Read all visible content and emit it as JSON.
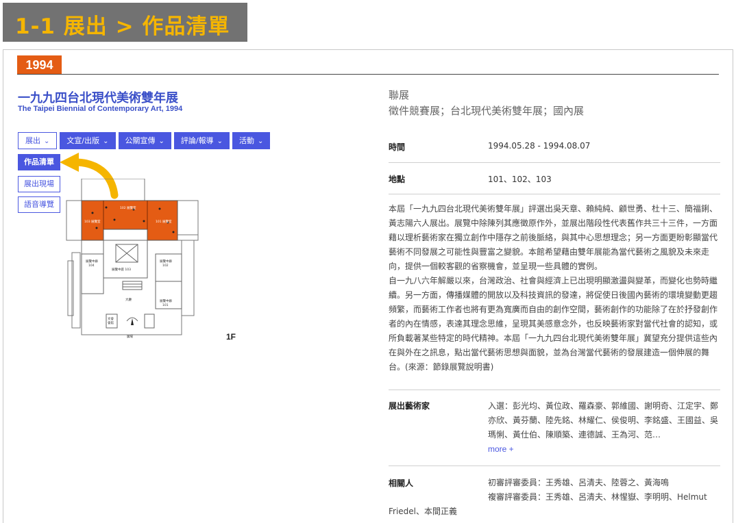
{
  "banner": {
    "title": "1-1 展出 > 作品清單"
  },
  "year": "1994",
  "exhibition": {
    "title_zh": "一九九四台北現代美術雙年展",
    "title_en": "The Taipei Biennial of Contemporary Art, 1994"
  },
  "tabs": [
    {
      "label": "展出",
      "chevron": "chevron-down-icon"
    },
    {
      "label": "文宣/出版",
      "chevron": "chevron-down-icon"
    },
    {
      "label": "公關宣傳",
      "chevron": "chevron-down-icon"
    },
    {
      "label": "評論/報導",
      "chevron": "chevron-down-icon"
    },
    {
      "label": "活動",
      "chevron": "chevron-down-icon"
    }
  ],
  "submenu": [
    {
      "label": "作品清單"
    },
    {
      "label": "展出現場"
    },
    {
      "label": "語音導覽"
    }
  ],
  "floorplan": {
    "floor": "1F",
    "rooms": [
      "103 展覽室",
      "102 展覽室",
      "101 展覽室",
      "展覽中廊 104",
      "展覽中庭 103",
      "展覽中廊 102",
      "大廳",
      "展覽中廊 101"
    ]
  },
  "info": {
    "category_label": "聯展",
    "category_value": "徵件競賽展；台北現代美術雙年展；國內展",
    "time_label": "時間",
    "time_value": "1994.05.28 - 1994.08.07",
    "place_label": "地點",
    "place_value": "101、102、103",
    "description_p1": "本屆「一九九四台北現代美術雙年展」評選出吳天章、賴純純、顧世勇、杜十三、簡福鋓、黃志陽六人展出。展覽中除陳列其應徵原作外，並展出階段性代表舊作共三十三件，一方面藉以理析藝術家在獨立創作中隱存之前後脈絡，與其中心思想理念；另一方面更盼彰顯當代藝術不同發展之可能性與豐富之變貌。本館希望藉由雙年展能為當代藝術之風貌及未來走向，提供一個較客觀的省察機會，並呈現一些具體的實例。",
    "description_p2": "自一九八六年解嚴以來，台灣政治、社會與經濟上已出現明顯激盪與變革，而變化也勢時繼續。另一方面，傳播媒體的開放以及科技資訊的發達，將促使日後國內藝術的環境變動更趨頻繁，而藝術工作者也將有更為寬廣而自由的創作空間，藝術創作的功能除了在於抒發創作者的內在情感，表達其理念思維，呈現其美感意念外，也反映藝術家對當代社會的認知，或所負載著某些特定的時代精神。本屆「一九九四台北現代美術雙年展」冀望充分提供這些內在與外在之訊息，點出當代藝術思想與面貌，並為台灣當代藝術的發展建造一個伸展的舞台。(來源：節錄展覽說明書)",
    "artists_label": "展出藝術家",
    "artists_value": "入選：彭光均、黃位政、羅森豪、郭維國、謝明奇、江定宇、鄭亦欣、黃芬蘭、陸先銘、林耀仁、侯俊明、李銘盛、王國益、吳瑪悧、黃仕伯、陳順築、連德誠、王為河、范…",
    "more_label": "more +",
    "related_label": "相關人",
    "related_line1": "初審評審委員：王秀雄、呂清夫、陸蓉之、黃海鳴",
    "related_line2": "複審評審委員：王秀雄、呂清夫、林惺嶽、李明明、Helmut Friedel、本間正義"
  }
}
